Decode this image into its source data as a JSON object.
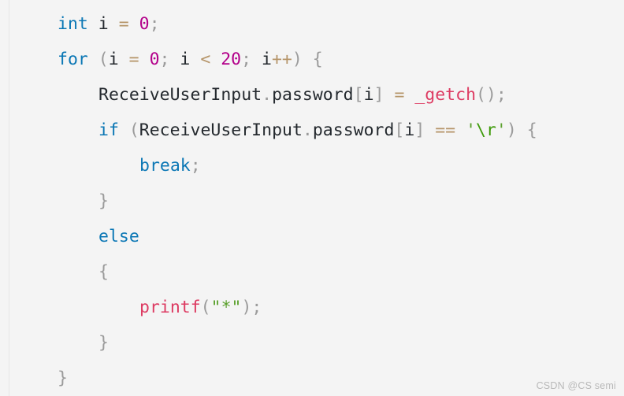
{
  "editor": {
    "background_color": "#f4f4f4",
    "language": "C",
    "font_size_px": 21.5,
    "line_height_px": 45
  },
  "colors": {
    "keyword": "#0b77b5",
    "number": "#b3008a",
    "operator": "#b59468",
    "punctuation": "#9b9b9b",
    "identifier": "#24292e",
    "function": "#dd3b62",
    "string": "#5aa02c",
    "escape": "#3f9b0b",
    "watermark": "#b9b9b9",
    "gutter_rule": "#e6e6e6"
  },
  "code": {
    "lines": [
      {
        "indent": 0,
        "tokens": [
          {
            "t": "int",
            "c": "keyword"
          },
          {
            "t": " ",
            "c": "plain"
          },
          {
            "t": "i",
            "c": "ident"
          },
          {
            "t": " ",
            "c": "plain"
          },
          {
            "t": "=",
            "c": "operator"
          },
          {
            "t": " ",
            "c": "plain"
          },
          {
            "t": "0",
            "c": "number"
          },
          {
            "t": ";",
            "c": "punct"
          }
        ]
      },
      {
        "indent": 0,
        "tokens": [
          {
            "t": "for",
            "c": "keyword"
          },
          {
            "t": " ",
            "c": "plain"
          },
          {
            "t": "(",
            "c": "punct"
          },
          {
            "t": "i",
            "c": "ident"
          },
          {
            "t": " ",
            "c": "plain"
          },
          {
            "t": "=",
            "c": "operator"
          },
          {
            "t": " ",
            "c": "plain"
          },
          {
            "t": "0",
            "c": "number"
          },
          {
            "t": ";",
            "c": "punct"
          },
          {
            "t": " ",
            "c": "plain"
          },
          {
            "t": "i",
            "c": "ident"
          },
          {
            "t": " ",
            "c": "plain"
          },
          {
            "t": "<",
            "c": "operator"
          },
          {
            "t": " ",
            "c": "plain"
          },
          {
            "t": "20",
            "c": "number"
          },
          {
            "t": ";",
            "c": "punct"
          },
          {
            "t": " ",
            "c": "plain"
          },
          {
            "t": "i",
            "c": "ident"
          },
          {
            "t": "++",
            "c": "operator"
          },
          {
            "t": ")",
            "c": "punct"
          },
          {
            "t": " ",
            "c": "plain"
          },
          {
            "t": "{",
            "c": "punct"
          }
        ]
      },
      {
        "indent": 1,
        "tokens": [
          {
            "t": "ReceiveUserInput",
            "c": "ident"
          },
          {
            "t": ".",
            "c": "punct"
          },
          {
            "t": "password",
            "c": "ident"
          },
          {
            "t": "[",
            "c": "punct"
          },
          {
            "t": "i",
            "c": "ident"
          },
          {
            "t": "]",
            "c": "punct"
          },
          {
            "t": " ",
            "c": "plain"
          },
          {
            "t": "=",
            "c": "operator"
          },
          {
            "t": " ",
            "c": "plain"
          },
          {
            "t": "_getch",
            "c": "func"
          },
          {
            "t": "(",
            "c": "punct"
          },
          {
            "t": ")",
            "c": "punct"
          },
          {
            "t": ";",
            "c": "punct"
          }
        ]
      },
      {
        "indent": 1,
        "tokens": [
          {
            "t": "if",
            "c": "keyword"
          },
          {
            "t": " ",
            "c": "plain"
          },
          {
            "t": "(",
            "c": "punct"
          },
          {
            "t": "ReceiveUserInput",
            "c": "ident"
          },
          {
            "t": ".",
            "c": "punct"
          },
          {
            "t": "password",
            "c": "ident"
          },
          {
            "t": "[",
            "c": "punct"
          },
          {
            "t": "i",
            "c": "ident"
          },
          {
            "t": "]",
            "c": "punct"
          },
          {
            "t": " ",
            "c": "plain"
          },
          {
            "t": "==",
            "c": "operator"
          },
          {
            "t": " ",
            "c": "plain"
          },
          {
            "t": "'",
            "c": "string"
          },
          {
            "t": "\\r",
            "c": "escape"
          },
          {
            "t": "'",
            "c": "string"
          },
          {
            "t": ")",
            "c": "punct"
          },
          {
            "t": " ",
            "c": "plain"
          },
          {
            "t": "{",
            "c": "punct"
          }
        ]
      },
      {
        "indent": 2,
        "tokens": [
          {
            "t": "break",
            "c": "keyword"
          },
          {
            "t": ";",
            "c": "punct"
          }
        ]
      },
      {
        "indent": 1,
        "tokens": [
          {
            "t": "}",
            "c": "punct"
          }
        ]
      },
      {
        "indent": 1,
        "tokens": [
          {
            "t": "else",
            "c": "keyword"
          }
        ]
      },
      {
        "indent": 1,
        "tokens": [
          {
            "t": "{",
            "c": "punct"
          }
        ]
      },
      {
        "indent": 2,
        "tokens": [
          {
            "t": "printf",
            "c": "func"
          },
          {
            "t": "(",
            "c": "punct"
          },
          {
            "t": "\"*\"",
            "c": "string"
          },
          {
            "t": ")",
            "c": "punct"
          },
          {
            "t": ";",
            "c": "punct"
          }
        ]
      },
      {
        "indent": 1,
        "tokens": [
          {
            "t": "}",
            "c": "punct"
          }
        ]
      },
      {
        "indent": 0,
        "tokens": [
          {
            "t": "}",
            "c": "punct"
          }
        ]
      }
    ],
    "plain_text": "int i = 0;\nfor (i = 0; i < 20; i++) {\n    ReceiveUserInput.password[i] = _getch();\n    if (ReceiveUserInput.password[i] == '\\r') {\n        break;\n    }\n    else\n    {\n        printf(\"*\");\n    }\n}"
  },
  "watermark": {
    "text": "CSDN @CS semi"
  }
}
